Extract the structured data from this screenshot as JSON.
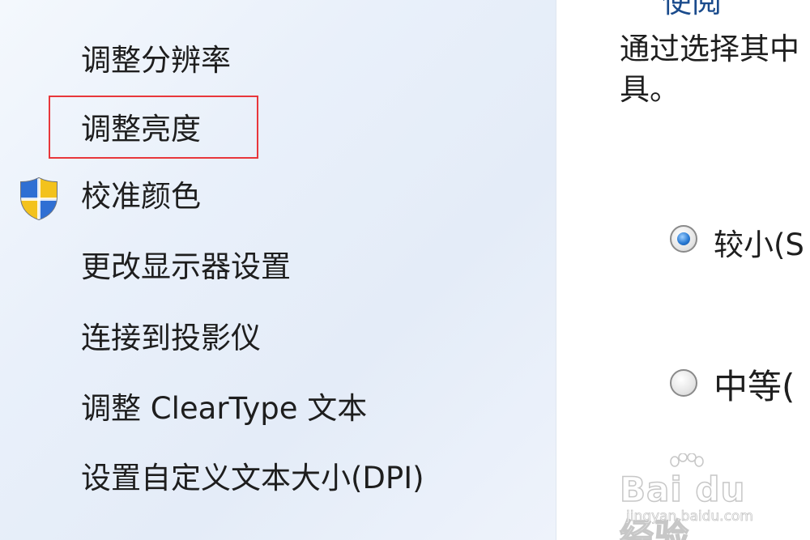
{
  "sidebar": {
    "items": [
      {
        "label": "调整分辨率"
      },
      {
        "label": "调整亮度"
      },
      {
        "label": "校准颜色"
      },
      {
        "label": "更改显示器设置"
      },
      {
        "label": "连接到投影仪"
      },
      {
        "label": "调整 ClearType 文本"
      },
      {
        "label": "设置自定义文本大小(DPI)"
      }
    ],
    "highlighted_index": 1,
    "highlight_color": "#e8373b"
  },
  "main": {
    "heading_partial": "使阅",
    "description_lines": [
      "通过选择其中",
      "具。"
    ],
    "options": [
      {
        "label": "较小(S",
        "checked": true
      },
      {
        "label": "中等(",
        "checked": false
      }
    ]
  },
  "watermark": {
    "brand": "Bai du 经验",
    "site": "jingyan.baidu.com"
  }
}
